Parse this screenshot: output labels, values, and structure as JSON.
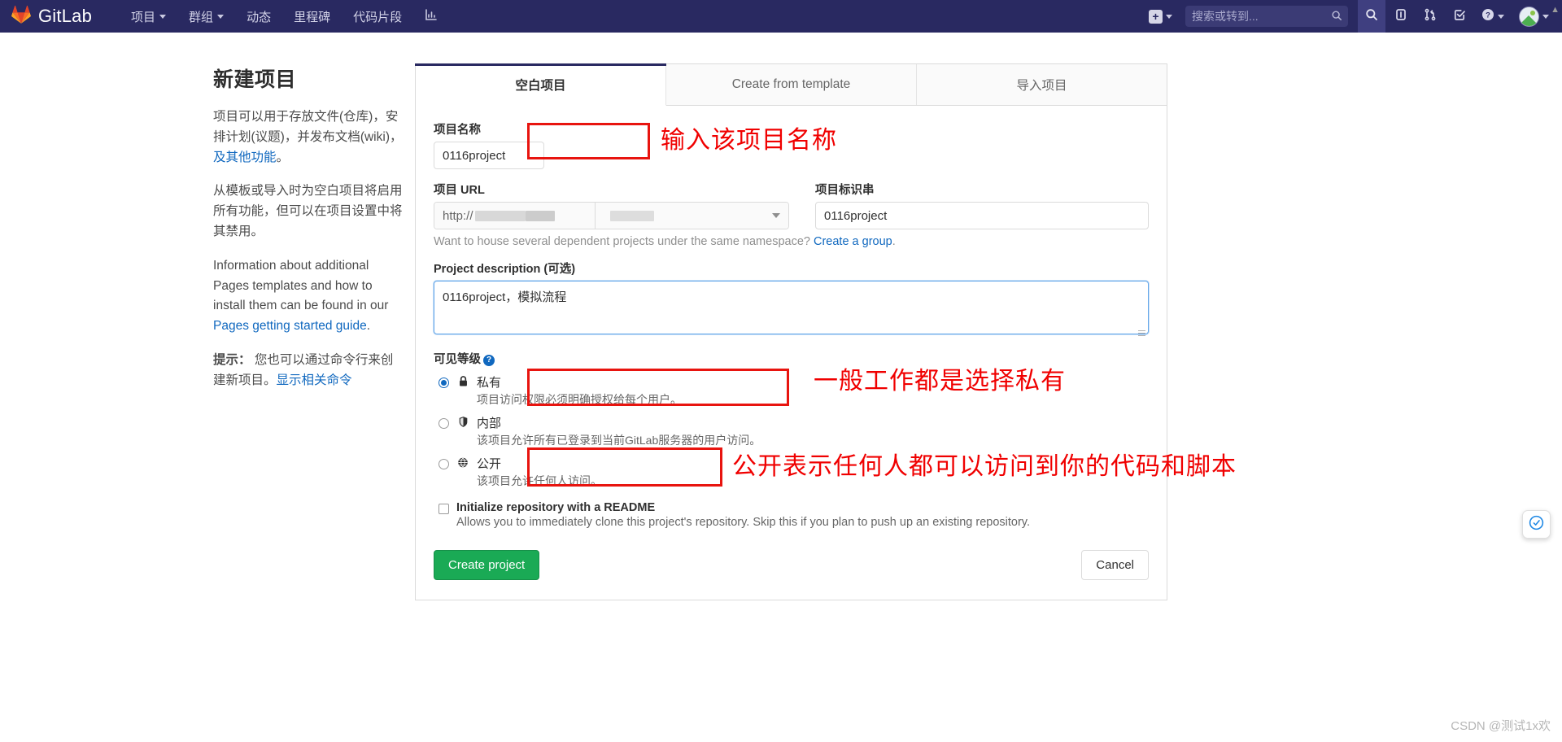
{
  "navbar": {
    "brand": "GitLab",
    "brand_icon": "gitlab-fox-logo",
    "links": [
      {
        "label": "项目",
        "icon": "chevron-down-icon"
      },
      {
        "label": "群组",
        "icon": "chevron-down-icon"
      },
      {
        "label": "动态",
        "icon": ""
      },
      {
        "label": "里程碑",
        "icon": ""
      },
      {
        "label": "代码片段",
        "icon": ""
      }
    ],
    "analytics_icon": "analytics-chart-icon",
    "plus_icon": "plus-square-icon",
    "plus_caret": "chevron-down-icon",
    "search": {
      "placeholder": "搜索或转到...",
      "icon": "search-icon"
    },
    "right_icons": [
      {
        "name": "search-icon"
      },
      {
        "name": "issues-icon"
      },
      {
        "name": "merge-requests-icon"
      },
      {
        "name": "todos-icon"
      },
      {
        "name": "help-icon"
      }
    ],
    "avatar": "user-avatar"
  },
  "sidebar": {
    "title": "新建项目",
    "p1_a": "项目可以用于存放文件(仓库)，安排计划(议题)，并发布文档(wiki)，",
    "p1_link": "及其他功能",
    "p1_b": "。",
    "p2": "从模板或导入时为空白项目将启用所有功能，但可以在项目设置中将其禁用。",
    "p3_a": "Information about additional Pages templates and how to install them can be found in our ",
    "p3_link": "Pages getting started guide",
    "p3_b": ".",
    "tip_label": "提示：",
    "tip_text": " 您也可以通过命令行来创建新项目。",
    "tip_link": "显示相关命令"
  },
  "tabs": [
    {
      "label": "空白项目",
      "active": true
    },
    {
      "label": "Create from template",
      "active": false
    },
    {
      "label": "导入项目",
      "active": false
    }
  ],
  "form": {
    "name_label": "项目名称",
    "name_value": "0116project",
    "url_label": "项目 URL",
    "url_prefix": "http://",
    "url_chevron": "chevron-down-icon",
    "slug_label": "项目标识串",
    "slug_value": "0116project",
    "namespace_help_a": "Want to house several dependent projects under the same namespace? ",
    "namespace_help_link": "Create a group",
    "namespace_help_b": ".",
    "desc_label": "Project description (可选)",
    "desc_value": "0116project，模拟流程",
    "visibility_label": "可见等级",
    "visibility_help_icon": "question-mark-icon",
    "visibility_options": [
      {
        "name": "私有",
        "icon": "lock-icon",
        "icon_glyph": "🔒",
        "desc": "项目访问权限必须明确授权给每个用户。",
        "selected": true
      },
      {
        "name": "内部",
        "icon": "shield-icon",
        "icon_glyph": "🛡",
        "desc": "该项目允许所有已登录到当前GitLab服务器的用户访问。",
        "selected": false
      },
      {
        "name": "公开",
        "icon": "globe-icon",
        "icon_glyph": "🌐",
        "desc": "该项目允许任何人访问。",
        "selected": false
      }
    ],
    "readme_label": "Initialize repository with a README",
    "readme_desc": "Allows you to immediately clone this project's repository. Skip this if you plan to push up an existing repository.",
    "readme_checked": false,
    "create_button": "Create project",
    "cancel_button": "Cancel"
  },
  "annotations": [
    {
      "text": "输入该项目名称"
    },
    {
      "text": "一般工作都是选择私有"
    },
    {
      "text": "公开表示任何人都可以访问到你的代码和脚本"
    }
  ],
  "watermark": "CSDN @测试1x欢",
  "float_widget_icon": "chat-widget-icon",
  "colors": {
    "navbar_bg": "#292961",
    "accent_red": "#e8140f",
    "link_blue": "#1068bf",
    "create_green": "#1aaa55"
  }
}
